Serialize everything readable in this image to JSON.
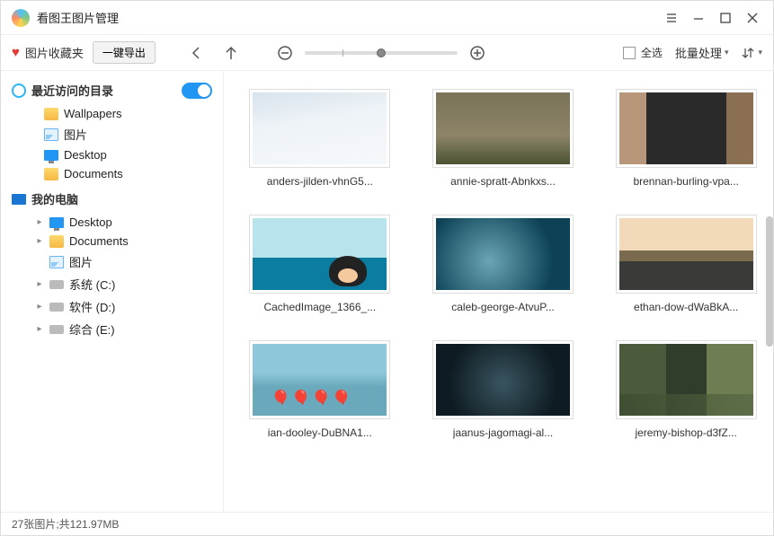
{
  "app": {
    "title": "看图王图片管理"
  },
  "toolbar": {
    "favorites": "图片收藏夹",
    "export": "一键导出",
    "select_all": "全选",
    "batch": "批量处理"
  },
  "sidebar": {
    "recent": "最近访问的目录",
    "recent_items": [
      "Wallpapers",
      "图片",
      "Desktop",
      "Documents"
    ],
    "my_pc": "我的电脑",
    "pc_items": [
      {
        "label": "Desktop",
        "t": "monitor",
        "exp": true
      },
      {
        "label": "Documents",
        "t": "folder",
        "exp": true
      },
      {
        "label": "图片",
        "t": "img",
        "exp": false
      },
      {
        "label": "系统 (C:)",
        "t": "drive",
        "exp": true
      },
      {
        "label": "软件 (D:)",
        "t": "drive",
        "exp": true
      },
      {
        "label": "综合 (E:)",
        "t": "drive",
        "exp": true
      }
    ]
  },
  "thumbs": [
    {
      "caption": "anders-jilden-vhnG5..."
    },
    {
      "caption": "annie-spratt-Abnkxs..."
    },
    {
      "caption": "brennan-burling-vpa..."
    },
    {
      "caption": "CachedImage_1366_..."
    },
    {
      "caption": "caleb-george-AtvuP..."
    },
    {
      "caption": "ethan-dow-dWaBkA..."
    },
    {
      "caption": "ian-dooley-DuBNA1..."
    },
    {
      "caption": "jaanus-jagomagi-al..."
    },
    {
      "caption": "jeremy-bishop-d3fZ..."
    }
  ],
  "status": "27张图片;共121.97MB"
}
